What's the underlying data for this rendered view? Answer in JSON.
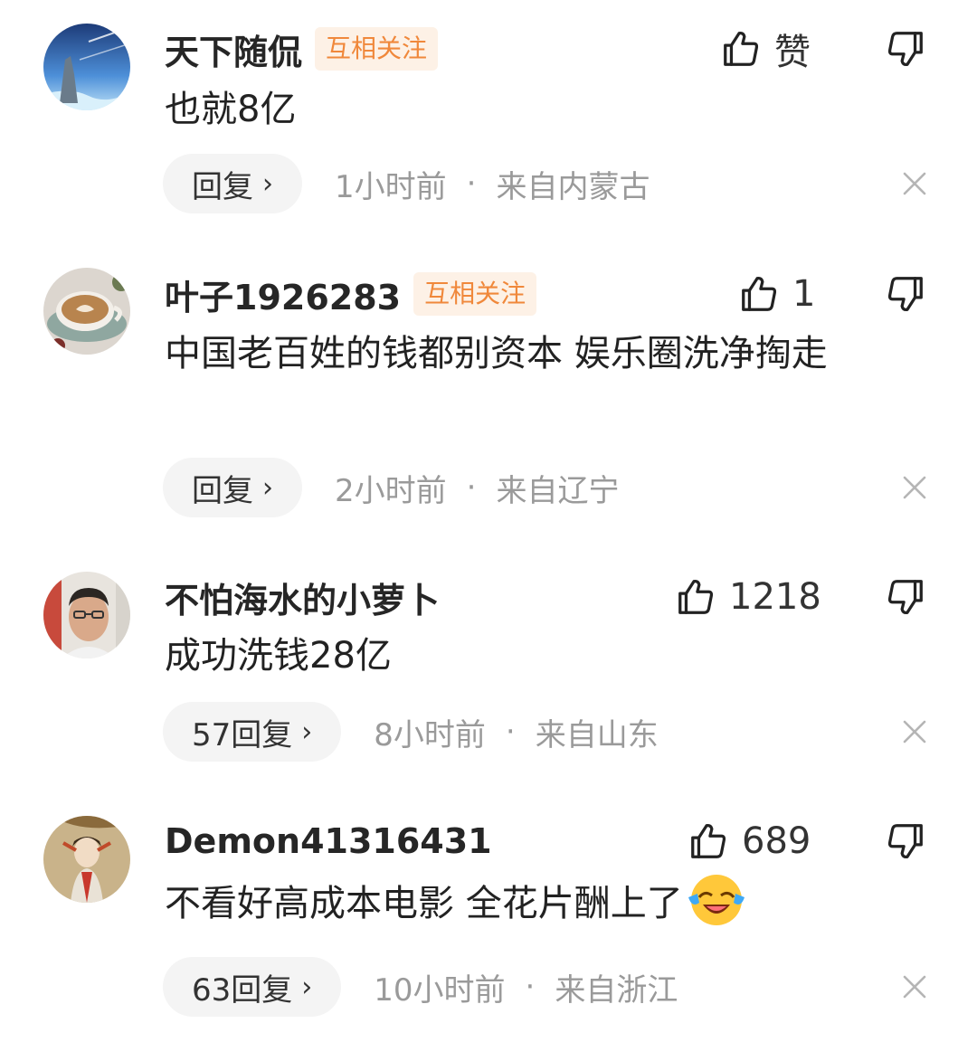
{
  "ui": {
    "reply_word": "回复",
    "mutual_follow": "互相关注",
    "separator": "·",
    "chevron": "›",
    "like_icon": "thumbs-up-outline",
    "dislike_icon": "thumbs-down-outline",
    "close_icon": "x",
    "accent_color": "#f0883b",
    "meta_color": "#9a9a9a"
  },
  "comments": [
    {
      "username": "天下随侃",
      "badge": "互相关注",
      "like_label": "赞",
      "text": "也就8亿",
      "reply_label": "回复",
      "time": "1小时前",
      "location": "来自内蒙古",
      "avatar": "landscape-avatar"
    },
    {
      "username": "叶子1926283",
      "badge": "互相关注",
      "like_label": "1",
      "text": "中国老百姓的钱都别资本 娱乐圈洗净掏走",
      "reply_label": "回复",
      "time": "2小时前",
      "location": "来自辽宁",
      "avatar": "coffee-avatar"
    },
    {
      "username": "不怕海水的小萝卜",
      "badge": "",
      "like_label": "1218",
      "text": "成功洗钱28亿",
      "reply_label": "57回复",
      "time": "8小时前",
      "location": "来自山东",
      "avatar": "man-avatar"
    },
    {
      "username": "Demon41316431",
      "badge": "",
      "like_label": "689",
      "text": "不看好高成本电影 全花片酬上了",
      "emoji": "laughing-crying-emoji",
      "reply_label": "63回复",
      "time": "10小时前",
      "location": "来自浙江",
      "avatar": "illustrated-woman-avatar"
    }
  ]
}
